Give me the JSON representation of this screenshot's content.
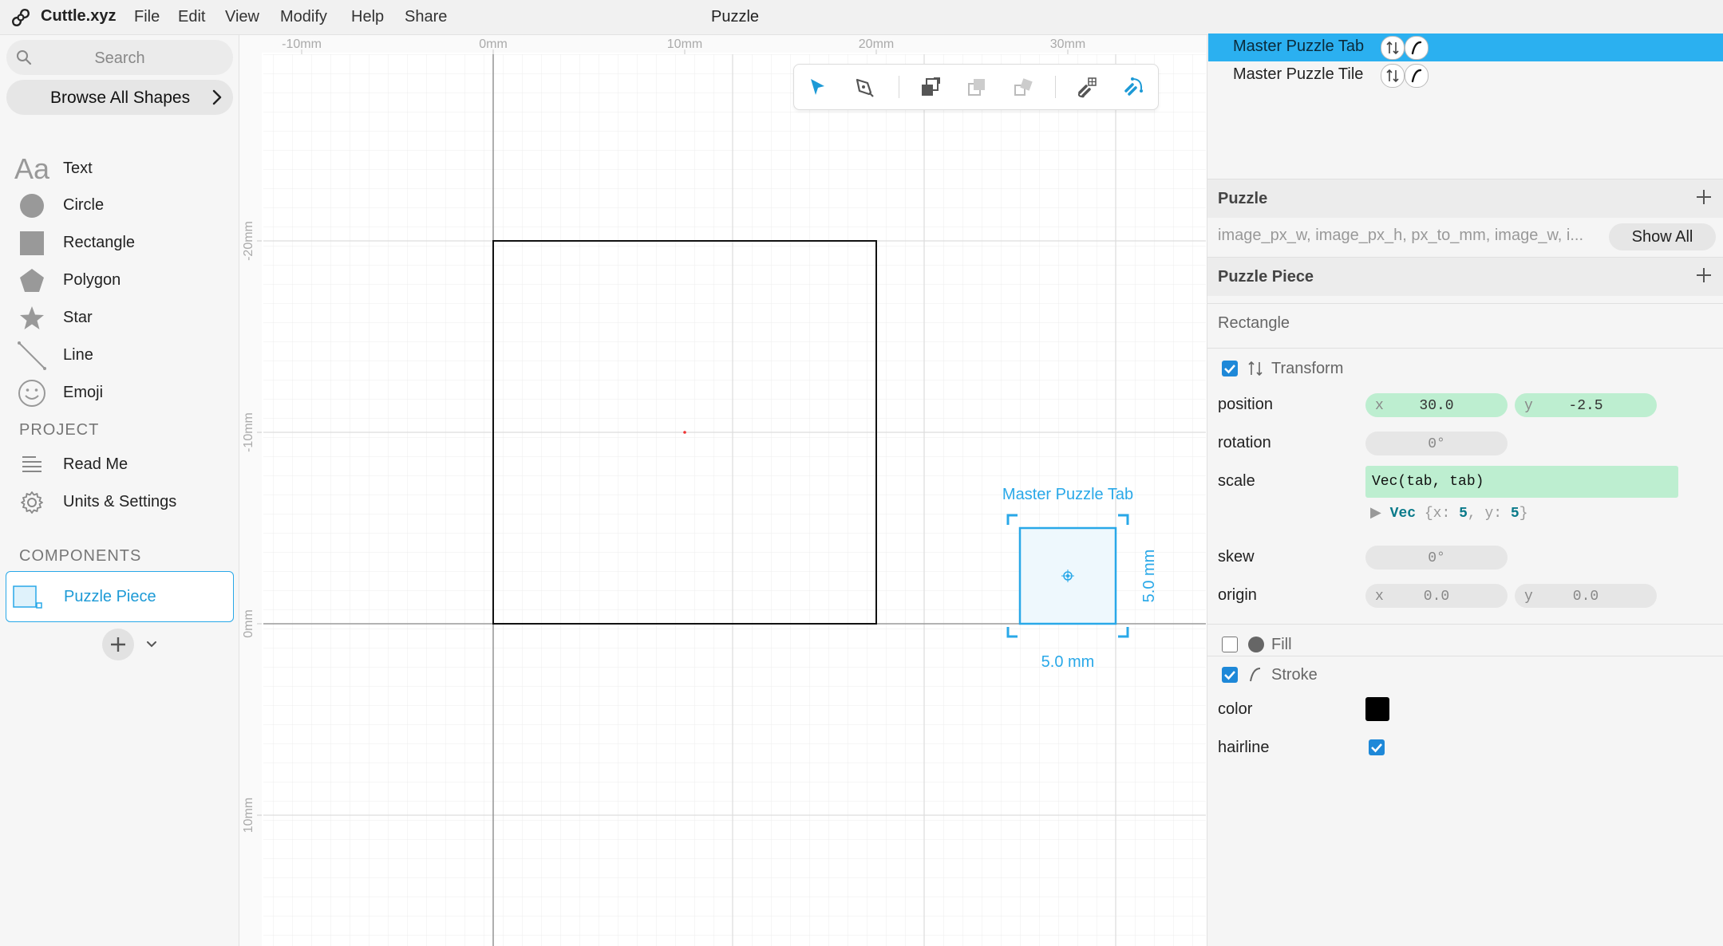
{
  "app": {
    "name": "Cuttle.xyz",
    "menus": [
      "File",
      "Edit",
      "View",
      "Modify",
      "Help",
      "Share"
    ],
    "document_title": "Puzzle"
  },
  "sidebar": {
    "search_placeholder": "Search",
    "browse_label": "Browse All Shapes",
    "shapes": [
      {
        "label": "Text",
        "icon": "text-aa-icon"
      },
      {
        "label": "Circle",
        "icon": "circle-icon"
      },
      {
        "label": "Rectangle",
        "icon": "rectangle-icon"
      },
      {
        "label": "Polygon",
        "icon": "pentagon-icon"
      },
      {
        "label": "Star",
        "icon": "star-icon"
      },
      {
        "label": "Line",
        "icon": "line-icon"
      },
      {
        "label": "Emoji",
        "icon": "smiley-icon"
      }
    ],
    "project_heading": "PROJECT",
    "project_items": [
      {
        "label": "Read Me",
        "icon": "document-lines-icon"
      },
      {
        "label": "Units & Settings",
        "icon": "gear-icon"
      }
    ],
    "components_heading": "COMPONENTS",
    "components": [
      {
        "label": "Puzzle Piece",
        "selected": true
      }
    ]
  },
  "canvas": {
    "ruler_top": [
      "-10mm",
      "0mm",
      "10mm",
      "20mm",
      "30mm"
    ],
    "ruler_left": [
      "-20mm",
      "-10mm",
      "0mm",
      "10mm"
    ],
    "selection_label": "Master Puzzle Tab",
    "width_label": "5.0 mm",
    "height_label": "5.0 mm"
  },
  "right": {
    "layers": [
      {
        "label": "Master Puzzle Tab",
        "selected": true
      },
      {
        "label": "Master Puzzle Tile",
        "selected": false
      }
    ],
    "puzzle_panel": {
      "title": "Puzzle",
      "params": "image_px_w, image_px_h, px_to_mm, image_w, i...",
      "show_all": "Show All"
    },
    "piece_panel": {
      "title": "Puzzle Piece"
    },
    "shape_type": "Rectangle",
    "transform": {
      "label": "Transform",
      "enabled": true,
      "position_label": "position",
      "position_x": "30.0",
      "position_y": "-2.5",
      "rotation_label": "rotation",
      "rotation": "0°",
      "scale_label": "scale",
      "scale_expr": "Vec(tab, tab)",
      "scale_preview_type": "Vec",
      "scale_preview_x": "5",
      "scale_preview_y": "5",
      "skew_label": "skew",
      "skew": "0°",
      "origin_label": "origin",
      "origin_x": "0.0",
      "origin_y": "0.0",
      "axis_x": "x",
      "axis_y": "y"
    },
    "fill": {
      "label": "Fill",
      "enabled": false
    },
    "stroke": {
      "label": "Stroke",
      "enabled": true,
      "color_label": "color",
      "color": "#000000",
      "hairline_label": "hairline",
      "hairline": true
    }
  },
  "colors": {
    "accent": "#2bb0f0",
    "selection_blue": "#29a8e8",
    "expression_green": "#bdeed0"
  }
}
